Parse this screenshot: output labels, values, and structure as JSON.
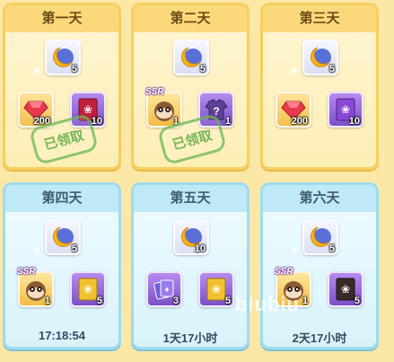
{
  "days": [
    {
      "title": "第一天",
      "top_reward": {
        "icon": "moon-orb-icon",
        "qty": "5"
      },
      "rewards": [
        {
          "icon": "ruby-gem-icon",
          "qty": "200",
          "ssr": ""
        },
        {
          "icon": "red-book-icon",
          "qty": "10",
          "ssr": ""
        }
      ],
      "claimed_stamp": "已领取",
      "timer": ""
    },
    {
      "title": "第二天",
      "top_reward": {
        "icon": "moon-orb-icon",
        "qty": "5"
      },
      "rewards": [
        {
          "icon": "raccoon-icon",
          "qty": "1",
          "ssr": "SSR"
        },
        {
          "icon": "mystery-shirt-icon",
          "qty": "1",
          "ssr": ""
        }
      ],
      "claimed_stamp": "已领取",
      "timer": ""
    },
    {
      "title": "第三天",
      "top_reward": {
        "icon": "moon-orb-icon",
        "qty": "5"
      },
      "rewards": [
        {
          "icon": "ruby-gem-icon",
          "qty": "200",
          "ssr": ""
        },
        {
          "icon": "purple-book-icon",
          "qty": "10",
          "ssr": ""
        }
      ],
      "claimed_stamp": "",
      "timer": ""
    },
    {
      "title": "第四天",
      "top_reward": {
        "icon": "moon-orb-icon",
        "qty": "5"
      },
      "rewards": [
        {
          "icon": "raccoon-icon",
          "qty": "1",
          "ssr": "SSR"
        },
        {
          "icon": "gold-book-icon",
          "qty": "5",
          "ssr": ""
        }
      ],
      "claimed_stamp": "",
      "timer": "17:18:54"
    },
    {
      "title": "第五天",
      "top_reward": {
        "icon": "moon-orb-icon",
        "qty": "10"
      },
      "rewards": [
        {
          "icon": "purple-cards-icon",
          "qty": "3",
          "ssr": ""
        },
        {
          "icon": "gold-book-icon",
          "qty": "5",
          "ssr": ""
        }
      ],
      "claimed_stamp": "",
      "timer": "1天17小时"
    },
    {
      "title": "第六天",
      "top_reward": {
        "icon": "moon-orb-icon",
        "qty": "5"
      },
      "rewards": [
        {
          "icon": "raccoon-icon",
          "qty": "1",
          "ssr": "SSR"
        },
        {
          "icon": "dark-book-icon",
          "qty": "5",
          "ssr": ""
        }
      ],
      "claimed_stamp": "",
      "timer": "2天17小时"
    }
  ],
  "watermark": "biubiu",
  "colors": {
    "gold_card": "#fdeeb5",
    "blue_card": "#d9f3fb",
    "stamp_green": "#5eaa46"
  }
}
